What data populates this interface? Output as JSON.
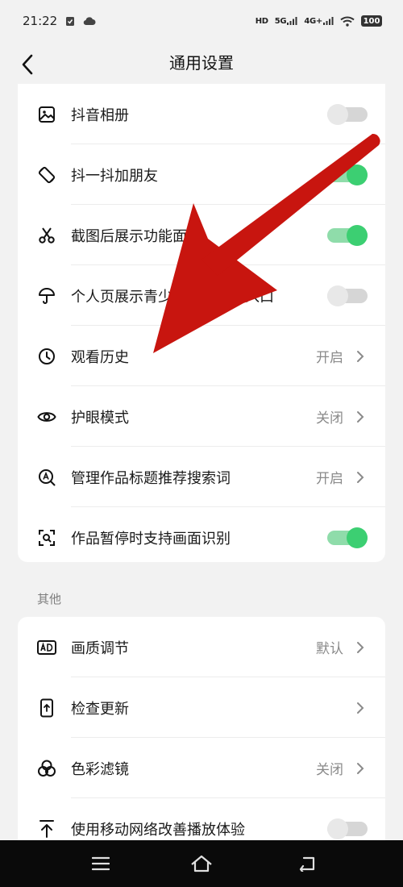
{
  "status_bar": {
    "time": "21:22",
    "hd": "HD",
    "net1": "5G",
    "net2": "4G+",
    "battery": "100"
  },
  "header": {
    "title": "通用设置"
  },
  "card1": {
    "rows": [
      {
        "label": "抖音相册",
        "icon": "image-icon",
        "toggle": false
      },
      {
        "label": "抖一抖加朋友",
        "icon": "rotate-phone-icon",
        "toggle": true
      },
      {
        "label": "截图后展示功能面板",
        "icon": "scissors-icon",
        "toggle": true
      },
      {
        "label": "个人页展示青少年模式快捷入口",
        "icon": "umbrella-icon",
        "toggle": false
      },
      {
        "label": "观看历史",
        "icon": "clock-icon",
        "value": "开启"
      },
      {
        "label": "护眼模式",
        "icon": "eye-icon",
        "value": "关闭"
      },
      {
        "label": "管理作品标题推荐搜索词",
        "icon": "search-a-icon",
        "value": "开启"
      },
      {
        "label": "作品暂停时支持画面识别",
        "icon": "scan-icon",
        "toggle": true
      }
    ]
  },
  "section_other": {
    "title": "其他"
  },
  "card2": {
    "rows": [
      {
        "label": "画质调节",
        "icon": "ad-icon",
        "value": "默认"
      },
      {
        "label": "检查更新",
        "icon": "phone-update-icon",
        "value": ""
      },
      {
        "label": "色彩滤镜",
        "icon": "color-filter-icon",
        "value": "关闭"
      },
      {
        "label": "使用移动网络改善播放体验",
        "icon": "upload-arrow-icon",
        "toggle": false
      }
    ]
  },
  "colors": {
    "toggle_on": "#3ccf72",
    "annotation_arrow": "#c8150f"
  }
}
